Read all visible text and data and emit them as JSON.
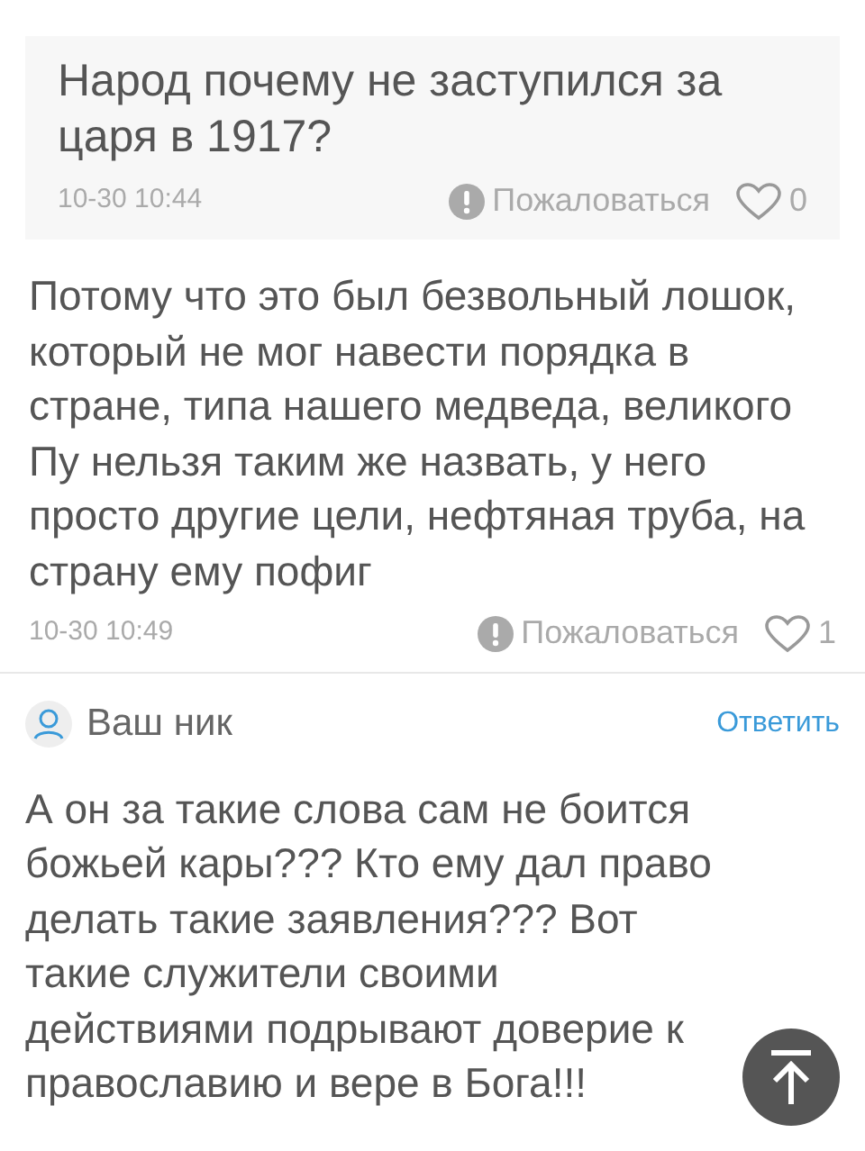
{
  "quote": {
    "text": "Народ почему не заступился за царя в 1917?",
    "time": "10-30 10:44",
    "report": "Пожаловаться",
    "likes": "0"
  },
  "answer": {
    "text": "Потому что это был безвольный лошок, который не мог навести порядка в стране, типа нашего медведа, великого Пу нельзя таким же назвать, у него просто другие цели, нефтяная труба, на страну ему пофиг",
    "time": "10-30 10:49",
    "report": "Пожаловаться",
    "likes": "1"
  },
  "next_comment": {
    "author": "Ваш ник",
    "reply": "Ответить",
    "text": "А он за такие слова сам не боится божьей кары??? Кто ему дал право делать такие заявления??? Вот такие служители своими действиями подрывают доверие к православию и вере в Бога!!!"
  }
}
